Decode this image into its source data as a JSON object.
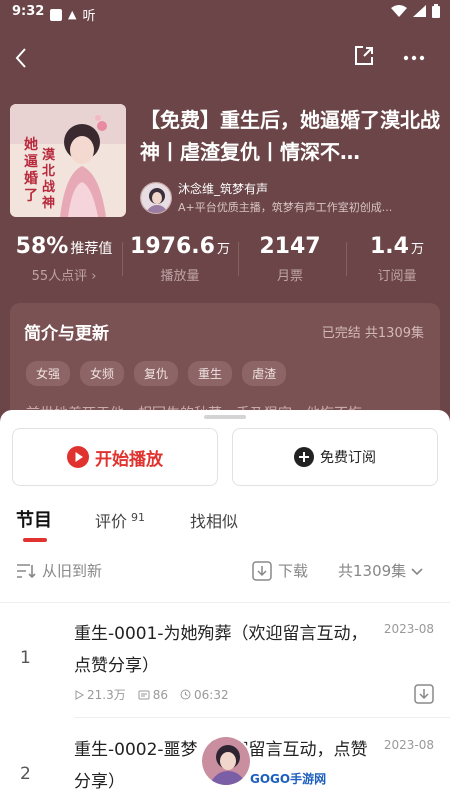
{
  "status_bar": {
    "time": "9:32",
    "app_char": "听"
  },
  "book": {
    "title": "【免费】重生后，她逼婚了漠北战神丨虐渣复仇丨情深不…",
    "cover_text": "她逼婚了漠北战神"
  },
  "author": {
    "name": "沐念维_筑梦有声",
    "desc": "A+平台优质主播，筑梦有声工作室初创成..."
  },
  "stats": [
    {
      "value": "58%",
      "unit": "推荐值",
      "label": "55人点评 ›"
    },
    {
      "value": "1976.6",
      "unit": "万",
      "label": "播放量"
    },
    {
      "value": "2147",
      "unit": "",
      "label": "月票"
    },
    {
      "value": "1.4",
      "unit": "万",
      "label": "订阅量"
    }
  ],
  "intro": {
    "title": "简介与更新",
    "status": "已完结 共1309集",
    "tags": [
      "女强",
      "女频",
      "复仇",
      "重生",
      "虐渣"
    ],
    "peek": "前世她差死于他，相回生的秋菜，手乃狠空，他悔不悔"
  },
  "actions": {
    "play": "开始播放",
    "subscribe": "免费订阅"
  },
  "tabs": [
    {
      "label": "节目",
      "count": ""
    },
    {
      "label": "评价",
      "count": "91"
    },
    {
      "label": "找相似",
      "count": ""
    }
  ],
  "toolbar": {
    "sort": "从旧到新",
    "download": "下载",
    "count": "共1309集"
  },
  "episodes": [
    {
      "index": "1",
      "title": "重生-0001-为她殉葬（欢迎留言互动，点赞分享）",
      "date": "2023-08",
      "plays": "21.3万",
      "comments": "86",
      "duration": "06:32"
    },
    {
      "index": "2",
      "title": "重生-0002-噩梦（欢迎留言互动，点赞分享）",
      "date": "2023-08",
      "plays": "",
      "comments": "",
      "duration": ""
    }
  ],
  "watermark": "GOGO手游网",
  "colors": {
    "header_bg": "#6b4547",
    "accent": "#e0332f"
  }
}
